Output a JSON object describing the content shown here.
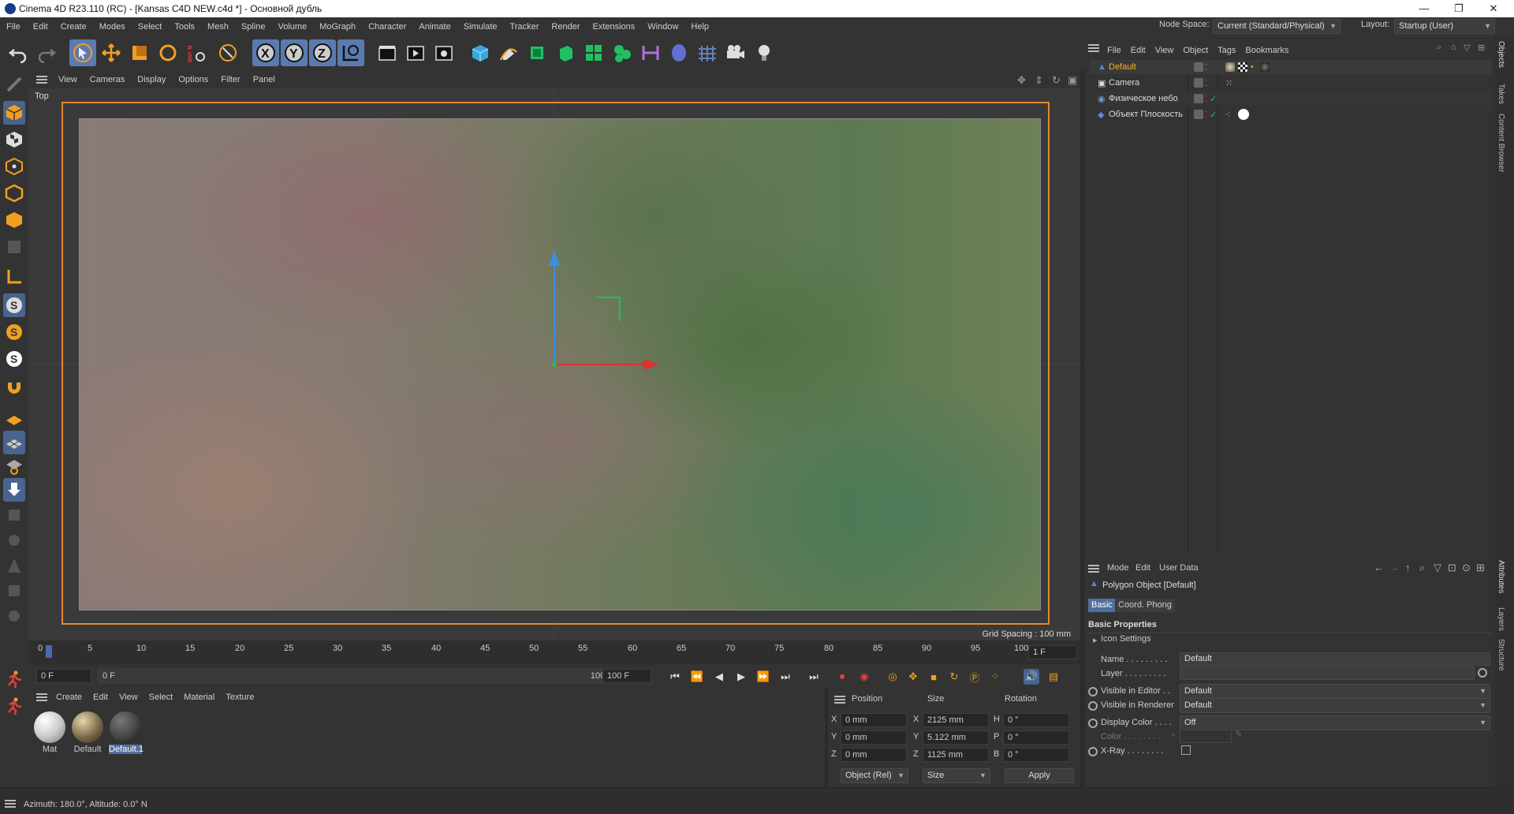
{
  "titlebar": {
    "title": "Cinema 4D R23.110 (RC) - [Kansas C4D NEW.c4d *] - Основной дубль",
    "minimize": "—",
    "maximize": "❐",
    "close": "✕"
  },
  "menubar": {
    "items": [
      "File",
      "Edit",
      "Create",
      "Modes",
      "Select",
      "Tools",
      "Mesh",
      "Spline",
      "Volume",
      "MoGraph",
      "Character",
      "Animate",
      "Simulate",
      "Tracker",
      "Render",
      "Extensions",
      "Window",
      "Help"
    ],
    "node_space_label": "Node Space:",
    "node_space_value": "Current (Standard/Physical)",
    "layout_label": "Layout:",
    "layout_value": "Startup (User)"
  },
  "viewport": {
    "menu": [
      "View",
      "Cameras",
      "Display",
      "Options",
      "Filter",
      "Panel"
    ],
    "view_name": "Top",
    "grid_spacing": "Grid Spacing : 100 mm"
  },
  "timeline": {
    "ticks": [
      "0",
      "5",
      "10",
      "15",
      "20",
      "25",
      "30",
      "35",
      "40",
      "45",
      "50",
      "55",
      "60",
      "65",
      "70",
      "75",
      "80",
      "85",
      "90",
      "95",
      "100"
    ],
    "current_frame": "1",
    "frame_field": "1 F"
  },
  "transport": {
    "start": "0 F",
    "current": "0 F",
    "end_inner": "100 F",
    "end": "100 F"
  },
  "material_manager": {
    "menu": [
      "Create",
      "Edit",
      "View",
      "Select",
      "Material",
      "Texture"
    ],
    "materials": [
      "Mat",
      "Default",
      "Default.1"
    ]
  },
  "coordinates": {
    "headers": [
      "Position",
      "Size",
      "Rotation"
    ],
    "rows": [
      {
        "axis": "X",
        "pos": "0 mm",
        "size_axis": "X",
        "size": "2125 mm",
        "rot_axis": "H",
        "rot": "0 °"
      },
      {
        "axis": "Y",
        "pos": "0 mm",
        "size_axis": "Y",
        "size": "5.122 mm",
        "rot_axis": "P",
        "rot": "0 °"
      },
      {
        "axis": "Z",
        "pos": "0 mm",
        "size_axis": "Z",
        "size": "1125 mm",
        "rot_axis": "B",
        "rot": "0 °"
      }
    ],
    "mode_select": "Object (Rel)",
    "size_select": "Size",
    "apply": "Apply"
  },
  "object_manager": {
    "menu": [
      "File",
      "Edit",
      "View",
      "Object",
      "Tags",
      "Bookmarks"
    ],
    "objects": [
      "Default",
      "Camera",
      "Физическое небо",
      "Объект Плоскость"
    ]
  },
  "attributes": {
    "menu": [
      "Mode",
      "Edit",
      "User Data"
    ],
    "object_title": "Polygon Object [Default]",
    "tabs": [
      "Basic",
      "Coord.",
      "Phong"
    ],
    "section": "Basic Properties",
    "icon_settings": "Icon Settings",
    "name_label": "Name . . . . . . . . .",
    "name_value": "Default",
    "layer_label": "Layer . . . . . . . . .",
    "visible_editor_label": "Visible in Editor . .",
    "visible_editor_value": "Default",
    "visible_renderer_label": "Visible in Renderer",
    "visible_renderer_value": "Default",
    "display_color_label": "Display Color . . . .",
    "display_color_value": "Off",
    "color_label": "Color . . . . . . . .",
    "xray_label": "X-Ray . . . . . . . ."
  },
  "right_tabs": [
    "Objects",
    "Takes",
    "Content Browser",
    "Attributes",
    "Layers",
    "Structure"
  ],
  "status": {
    "text": "Azimuth: 180.0°, Altitude: 0.0°  N"
  },
  "colors": {
    "accent": "#5b7ab0",
    "frame": "#e08c28",
    "selected_object": "#f0b030"
  }
}
